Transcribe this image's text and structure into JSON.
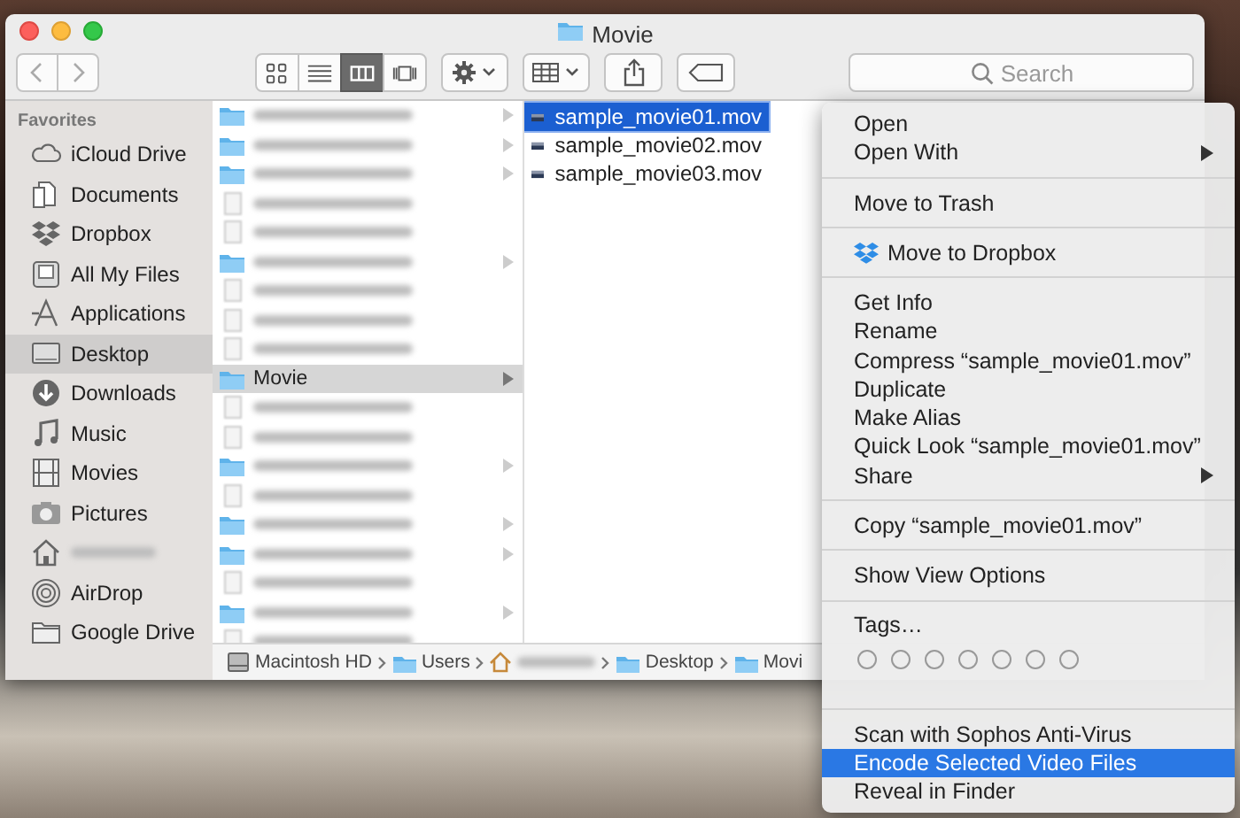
{
  "window": {
    "title": "Movie"
  },
  "toolbar": {
    "view_buttons": [
      {
        "kind": "icons",
        "selected": false
      },
      {
        "kind": "list",
        "selected": false
      },
      {
        "kind": "columns",
        "selected": true
      },
      {
        "kind": "coverflow",
        "selected": false
      }
    ],
    "search": {
      "placeholder": "Search"
    }
  },
  "sidebar": {
    "heading": "Favorites",
    "items": [
      {
        "label": "iCloud Drive",
        "kind": "cloud",
        "selected": false
      },
      {
        "label": "Documents",
        "kind": "document",
        "selected": false
      },
      {
        "label": "Dropbox",
        "kind": "dropbox",
        "selected": false
      },
      {
        "label": "All My Files",
        "kind": "files",
        "selected": false
      },
      {
        "label": "Applications",
        "kind": "apps",
        "selected": false
      },
      {
        "label": "Desktop",
        "kind": "desktop",
        "selected": true
      },
      {
        "label": "Downloads",
        "kind": "download",
        "selected": false
      },
      {
        "label": "Music",
        "kind": "music",
        "selected": false
      },
      {
        "label": "Movies",
        "kind": "film",
        "selected": false
      },
      {
        "label": "Pictures",
        "kind": "camera",
        "selected": false
      },
      {
        "kind": "home",
        "selected": false
      },
      {
        "label": "AirDrop",
        "kind": "airdrop",
        "selected": false
      },
      {
        "label": "Google Drive",
        "kind": "folder",
        "selected": false
      }
    ]
  },
  "column_1": [
    {
      "kind": "folder",
      "selected": false
    },
    {
      "kind": "folder",
      "selected": false
    },
    {
      "kind": "folder",
      "selected": false
    },
    {
      "kind": "file",
      "selected": false
    },
    {
      "kind": "file",
      "selected": false
    },
    {
      "kind": "folder",
      "selected": false
    },
    {
      "kind": "file",
      "selected": false
    },
    {
      "kind": "file",
      "selected": false
    },
    {
      "kind": "file",
      "selected": false
    },
    {
      "kind": "folder",
      "label": "Movie",
      "selected": true
    },
    {
      "kind": "file",
      "selected": false
    },
    {
      "kind": "file",
      "selected": false
    },
    {
      "kind": "folder",
      "selected": false
    },
    {
      "kind": "file",
      "selected": false
    },
    {
      "kind": "folder",
      "selected": false
    },
    {
      "kind": "folder",
      "selected": false
    },
    {
      "kind": "file",
      "selected": false
    },
    {
      "kind": "folder",
      "selected": false
    },
    {
      "kind": "file",
      "selected": false
    }
  ],
  "column_2": [
    {
      "label": "sample_movie01.mov",
      "selected": true
    },
    {
      "label": "sample_movie02.mov",
      "selected": false
    },
    {
      "label": "sample_movie03.mov",
      "selected": false
    }
  ],
  "path_bar": [
    {
      "kind": "disk",
      "label": "Macintosh HD"
    },
    {
      "kind": "folder",
      "label": "Users"
    },
    {
      "kind": "home"
    },
    {
      "kind": "folder",
      "label": "Desktop"
    },
    {
      "kind": "folder",
      "label": "Movi"
    }
  ],
  "context_menu": [
    [
      {
        "kind": "item",
        "label": "Open",
        "submenu": false,
        "selected": false
      },
      {
        "kind": "item",
        "label": "Open With",
        "submenu": true,
        "selected": false
      }
    ],
    [
      {
        "kind": "item",
        "label": "Move to Trash",
        "submenu": false,
        "selected": false
      }
    ],
    [
      {
        "kind": "dropbox",
        "label": "Move to Dropbox",
        "submenu": false,
        "selected": false
      }
    ],
    [
      {
        "kind": "item",
        "label": "Get Info",
        "submenu": false,
        "selected": false
      },
      {
        "kind": "item",
        "label": "Rename",
        "submenu": false,
        "selected": false
      },
      {
        "kind": "item",
        "label": "Compress “sample_movie01.mov”",
        "submenu": false,
        "selected": false
      },
      {
        "kind": "item",
        "label": "Duplicate",
        "submenu": false,
        "selected": false
      },
      {
        "kind": "item",
        "label": "Make Alias",
        "submenu": false,
        "selected": false
      },
      {
        "kind": "item",
        "label": "Quick Look “sample_movie01.mov”",
        "submenu": false,
        "selected": false
      },
      {
        "kind": "item",
        "label": "Share",
        "submenu": true,
        "selected": false
      }
    ],
    [
      {
        "kind": "item",
        "label": "Copy “sample_movie01.mov”",
        "submenu": false,
        "selected": false
      }
    ],
    [
      {
        "kind": "item",
        "label": "Show View Options",
        "submenu": false,
        "selected": false
      }
    ],
    [
      {
        "kind": "item",
        "label": "Tags…",
        "submenu": false,
        "selected": false
      },
      {
        "kind": "tags",
        "circles": [
          {
            "filled": false
          },
          {
            "filled": false
          },
          {
            "filled": false
          },
          {
            "filled": false
          },
          {
            "filled": false
          },
          {
            "filled": false
          },
          {
            "filled": false
          }
        ]
      }
    ],
    [
      {
        "kind": "item",
        "label": "Scan with Sophos Anti-Virus",
        "submenu": false,
        "selected": false
      },
      {
        "kind": "item",
        "label": "Encode Selected Video Files",
        "submenu": false,
        "selected": true
      },
      {
        "kind": "item",
        "label": "Reveal in Finder",
        "submenu": false,
        "selected": false
      }
    ]
  ]
}
